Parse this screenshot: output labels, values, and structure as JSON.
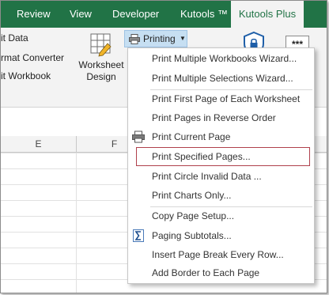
{
  "tabs": [
    {
      "label": "Review",
      "active": false
    },
    {
      "label": "View",
      "active": false
    },
    {
      "label": "Developer",
      "active": false
    },
    {
      "label": "Kutools ™",
      "active": false
    },
    {
      "label": "Kutools Plus",
      "active": true
    }
  ],
  "ribbon": {
    "left_items": [
      "it Data",
      "rmat Converter",
      "it Workbook"
    ],
    "worksheet_design": {
      "line1": "Worksheet",
      "line2": "Design"
    },
    "printing_button": "Printing",
    "more_label": "***"
  },
  "columns": [
    "E",
    "F"
  ],
  "menu": {
    "items": [
      {
        "label": "Print Multiple Workbooks Wizard...",
        "icon": ""
      },
      {
        "label": "Print Multiple Selections Wizard...",
        "icon": ""
      },
      {
        "label": "Print First Page of Each Worksheet",
        "icon": ""
      },
      {
        "label": "Print Pages in Reverse Order",
        "icon": ""
      },
      {
        "label": "Print Current Page",
        "icon": "printer-icon"
      },
      {
        "label": "Print Specified Pages...",
        "icon": "",
        "highlighted": true
      },
      {
        "label": "Print Circle Invalid Data ...",
        "icon": ""
      },
      {
        "label": "Print Charts Only...",
        "icon": ""
      },
      {
        "label": "Copy Page Setup...",
        "icon": ""
      },
      {
        "label": "Paging Subtotals...",
        "icon": "sigma-icon"
      },
      {
        "label": "Insert Page Break Every Row...",
        "icon": ""
      },
      {
        "label": "Add Border to Each Page",
        "icon": ""
      }
    ]
  },
  "colors": {
    "ribbon_green": "#217346",
    "highlight_border": "#b0404c",
    "printing_button_bg": "#c6dff2"
  }
}
